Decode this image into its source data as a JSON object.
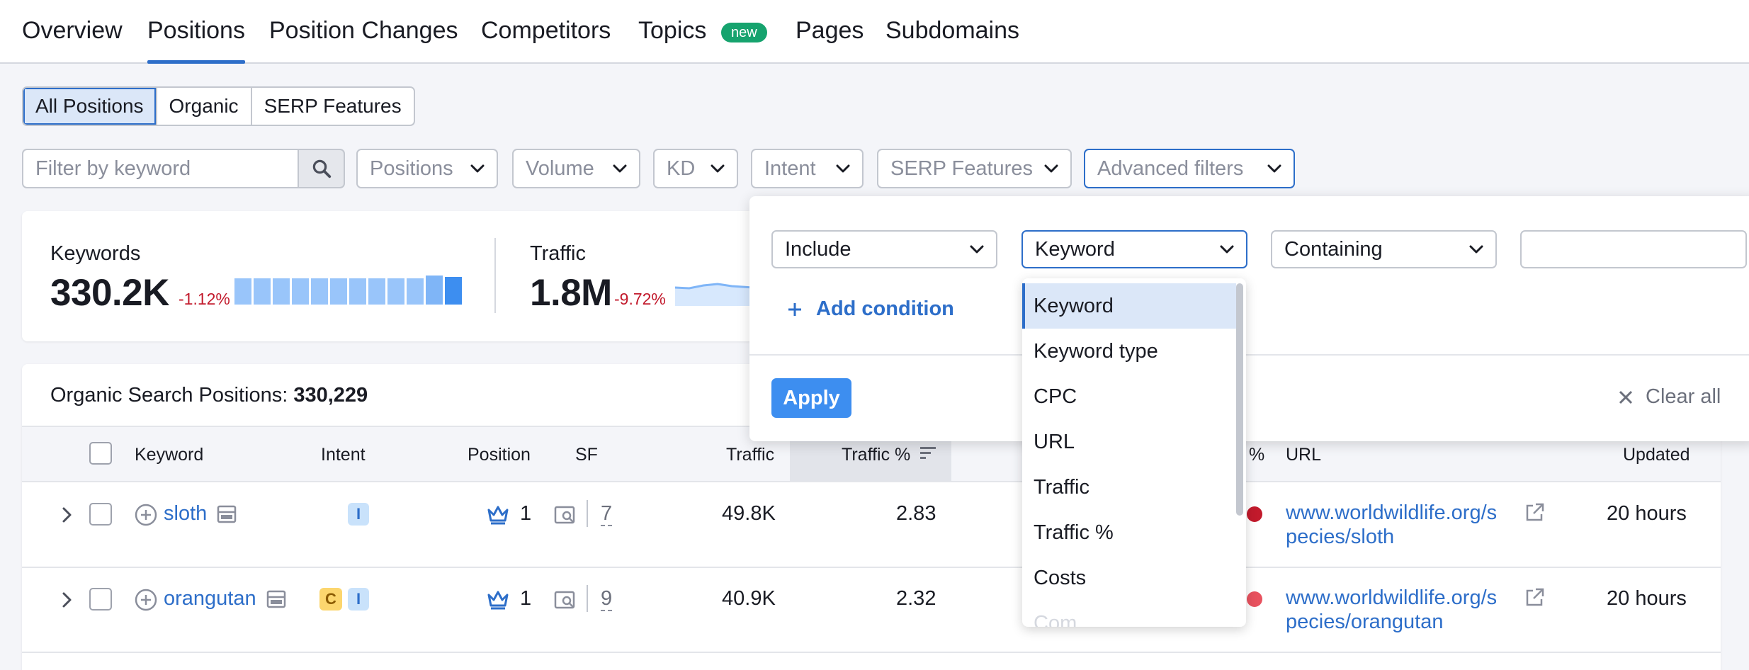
{
  "nav": {
    "tabs": [
      {
        "label": "Overview"
      },
      {
        "label": "Positions"
      },
      {
        "label": "Position Changes"
      },
      {
        "label": "Competitors"
      },
      {
        "label": "Topics"
      },
      {
        "label": "Pages"
      },
      {
        "label": "Subdomains"
      }
    ],
    "active_tab": "Positions",
    "new_badge": "new"
  },
  "segment": {
    "items": [
      {
        "label": "All Positions"
      },
      {
        "label": "Organic"
      },
      {
        "label": "SERP Features"
      }
    ],
    "active": "All Positions"
  },
  "filters": {
    "keyword_placeholder": "Filter by keyword",
    "dropdowns": [
      {
        "label": "Positions"
      },
      {
        "label": "Volume"
      },
      {
        "label": "KD"
      },
      {
        "label": "Intent"
      },
      {
        "label": "SERP Features"
      },
      {
        "label": "Advanced filters"
      }
    ]
  },
  "summary": {
    "keywords": {
      "label": "Keywords",
      "value": "330.2K",
      "delta": "-1.12%"
    },
    "traffic": {
      "label": "Traffic",
      "value": "1.8M",
      "delta": "-9.72%"
    }
  },
  "table": {
    "title_prefix": "Organic Search Positions:",
    "title_count": "330,229",
    "columns": [
      "Keyword",
      "Intent",
      "Position",
      "SF",
      "Traffic",
      "Traffic %",
      "%",
      "URL",
      "Updated"
    ],
    "rows": [
      {
        "keyword": "sloth",
        "intents": [
          "I"
        ],
        "position": "1",
        "sf": "7",
        "traffic": "49.8K",
        "traffic_pct": "2.83",
        "url_line1": "www.worldwildlife.org/s",
        "url_line2": "pecies/sloth",
        "updated": "20 hours"
      },
      {
        "keyword": "orangutan",
        "intents": [
          "C",
          "I"
        ],
        "position": "1",
        "sf": "9",
        "traffic": "40.9K",
        "traffic_pct": "2.32",
        "url_line1": "www.worldwildlife.org/s",
        "url_line2": "pecies/orangutan",
        "updated": "20 hours"
      }
    ]
  },
  "advanced": {
    "include": "Include",
    "field": "Keyword",
    "operator": "Containing",
    "value": "",
    "add_condition": "Add condition",
    "apply": "Apply",
    "clear_all": "Clear all",
    "menu_items": [
      {
        "label": "Keyword",
        "selected": true
      },
      {
        "label": "Keyword type"
      },
      {
        "label": "CPC"
      },
      {
        "label": "URL"
      },
      {
        "label": "Traffic"
      },
      {
        "label": "Traffic %"
      },
      {
        "label": "Costs"
      },
      {
        "label": "Com"
      }
    ]
  },
  "colors": {
    "accent": "#2d6ec9",
    "apply_button": "#3d8ef0",
    "negative_delta": "#c21a2c",
    "new_badge": "#16a36e",
    "sparkline": "#99c5fa"
  },
  "icons": [
    "search-icon",
    "chevron-down-icon",
    "plus-icon",
    "close-icon",
    "expand-chevron-icon",
    "add-keyword-icon",
    "serp-snippet-icon",
    "crown-icon",
    "serp-search-icon",
    "external-link-icon"
  ]
}
